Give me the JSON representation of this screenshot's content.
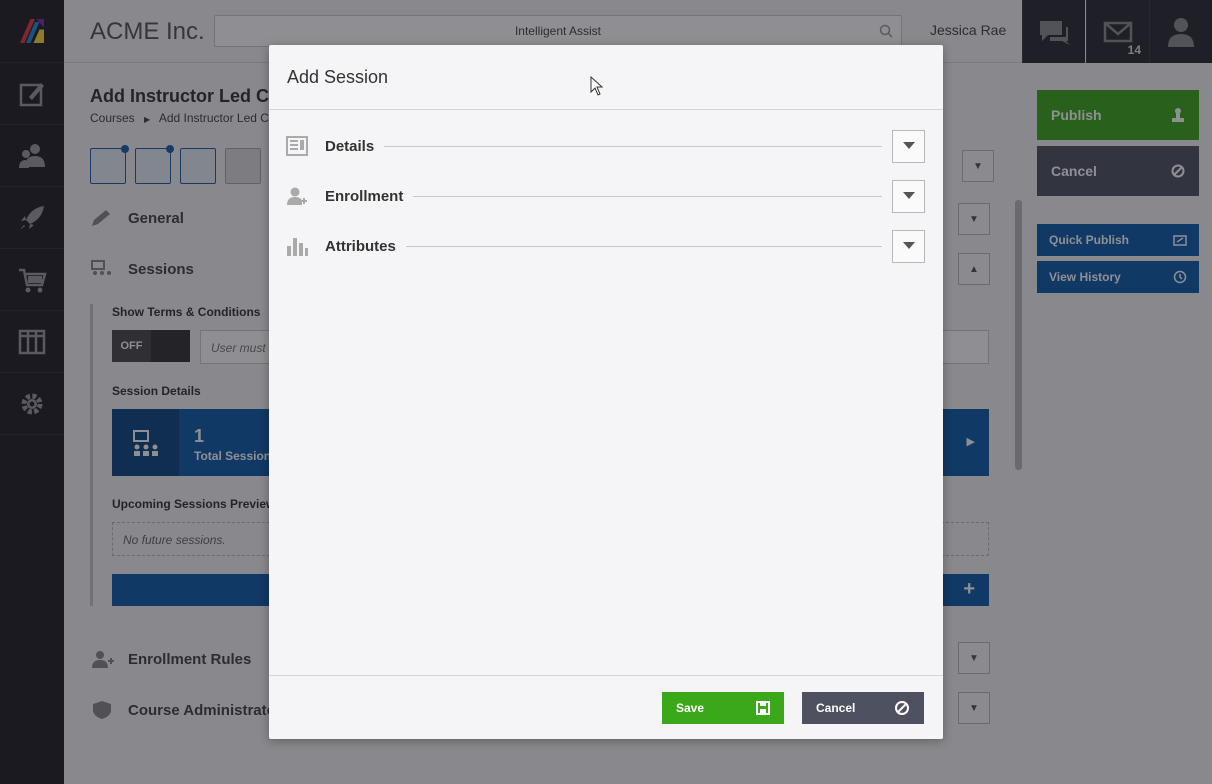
{
  "app": {
    "brand": "ACME Inc.",
    "search_placeholder": "Intelligent Assist",
    "user_name": "Jessica Rae",
    "mail_count": "14"
  },
  "page": {
    "title": "Add Instructor Led Co",
    "breadcrumb_root": "Courses",
    "breadcrumb_current": "Add Instructor Led Co",
    "sections": {
      "general": "General",
      "sessions": "Sessions",
      "enrollment_rules": "Enrollment Rules",
      "course_admin": "Course Administrato"
    },
    "show_terms_label": "Show Terms & Conditions",
    "toggle_off": "OFF",
    "terms_placeholder": "User must a",
    "session_details_label": "Session Details",
    "total_sessions_count": "1",
    "total_sessions_label": "Total Sessions",
    "upcoming_label": "Upcoming Sessions Preview",
    "no_future": "No future sessions."
  },
  "sidebar_right": {
    "publish": "Publish",
    "cancel": "Cancel",
    "quick_publish": "Quick Publish",
    "view_history": "View History"
  },
  "modal": {
    "title": "Add Session",
    "rows": [
      {
        "label": "Details",
        "icon": "details-icon"
      },
      {
        "label": "Enrollment",
        "icon": "enrollment-icon"
      },
      {
        "label": "Attributes",
        "icon": "attributes-icon"
      }
    ],
    "save": "Save",
    "cancel": "Cancel"
  },
  "colors": {
    "green": "#3aa81a",
    "blue": "#0d5aa7",
    "dark": "#1f1f24",
    "cancel_gray": "#4e5160"
  }
}
